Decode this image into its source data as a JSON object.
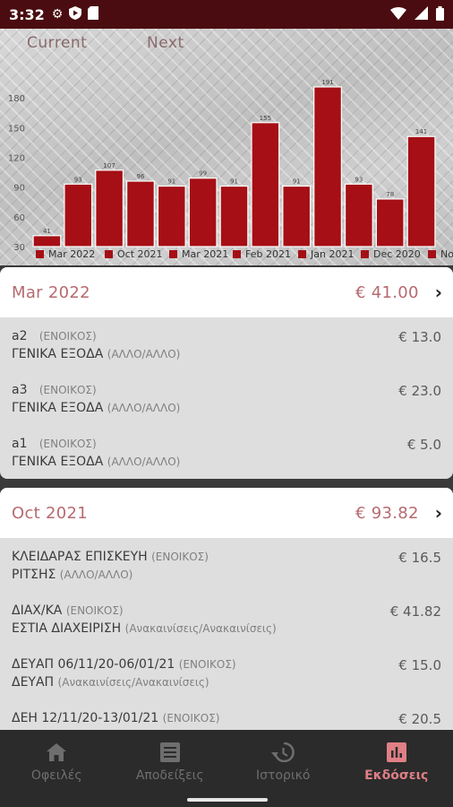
{
  "status_bar": {
    "time": "3:32"
  },
  "chart": {
    "tabs": {
      "current": "Current",
      "next": "Next"
    }
  },
  "chart_data": {
    "type": "bar",
    "categories": [
      "Mar 2022",
      "Oct 2021",
      "Mar 2021",
      "Feb 2021",
      "Jan 2021",
      "Dec 2020",
      "No"
    ],
    "values": [
      41,
      93,
      107,
      96,
      91,
      99,
      91,
      155,
      91,
      191,
      93,
      78,
      141
    ],
    "value_labels": [
      "41",
      "93",
      "107",
      "96",
      "91",
      "99",
      "91",
      "155",
      "91",
      "191",
      "93",
      "78",
      "141"
    ],
    "y_ticks": [
      30,
      60,
      90,
      120,
      150,
      180
    ],
    "ylim": [
      30,
      200
    ],
    "color": "#a50f15",
    "grid": false,
    "legend_position": "bottom"
  },
  "cards": [
    {
      "title": "Mar 2022",
      "total": "€ 41.00",
      "items": [
        {
          "name": "a2",
          "tag": "(ΕΝΟΙΚΟΣ)",
          "category": "ΓΕΝΙΚΑ ΕΞΟΔΑ",
          "subcat": "(ΑΛΛΟ/ΑΛΛΟ)",
          "amount": "€ 13.0"
        },
        {
          "name": "a3",
          "tag": "(ΕΝΟΙΚΟΣ)",
          "category": "ΓΕΝΙΚΑ ΕΞΟΔΑ",
          "subcat": "(ΑΛΛΟ/ΑΛΛΟ)",
          "amount": "€ 23.0"
        },
        {
          "name": "a1",
          "tag": "(ΕΝΟΙΚΟΣ)",
          "category": "ΓΕΝΙΚΑ ΕΞΟΔΑ",
          "subcat": "(ΑΛΛΟ/ΑΛΛΟ)",
          "amount": "€ 5.0"
        }
      ]
    },
    {
      "title": "Oct 2021",
      "total": "€ 93.82",
      "items": [
        {
          "name": "ΚΛΕΙΔΑΡΑΣ ΕΠΙΣΚΕΥΗ",
          "tag": "(ΕΝΟΙΚΟΣ)",
          "category": "ΡΙΤΣΗΣ",
          "subcat": "(ΑΛΛΟ/ΑΛΛΟ)",
          "amount": "€ 16.5"
        },
        {
          "name": "ΔΙΑΧ/ΚΑ",
          "tag": "(ΕΝΟΙΚΟΣ)",
          "category": "ΕΣΤΙΑ ΔΙΑΧΕΙΡΙΣΗ",
          "subcat": "(Ανακαινίσεις/Ανακαινίσεις)",
          "amount": "€ 41.82"
        },
        {
          "name": "ΔΕΥΑΠ 06/11/20-06/01/21",
          "tag": "(ΕΝΟΙΚΟΣ)",
          "category": "ΔΕΥΑΠ",
          "subcat": "(Ανακαινίσεις/Ανακαινίσεις)",
          "amount": "€ 15.0"
        },
        {
          "name": "ΔΕΗ 12/11/20-13/01/21",
          "tag": "(ΕΝΟΙΚΟΣ)",
          "category": "",
          "subcat": "",
          "amount": "€ 20.5"
        }
      ]
    }
  ],
  "bottom_nav": {
    "items": [
      {
        "label": "Οφειλές",
        "icon": "home-icon"
      },
      {
        "label": "Αποδείξεις",
        "icon": "receipt-icon"
      },
      {
        "label": "Ιστορικό",
        "icon": "history-icon"
      },
      {
        "label": "Εκδόσεις",
        "icon": "bar-chart-icon",
        "active": true
      }
    ]
  },
  "colors": {
    "accent": "#e07f86",
    "bar": "#a50f15",
    "status_bar": "#4a0c10"
  }
}
